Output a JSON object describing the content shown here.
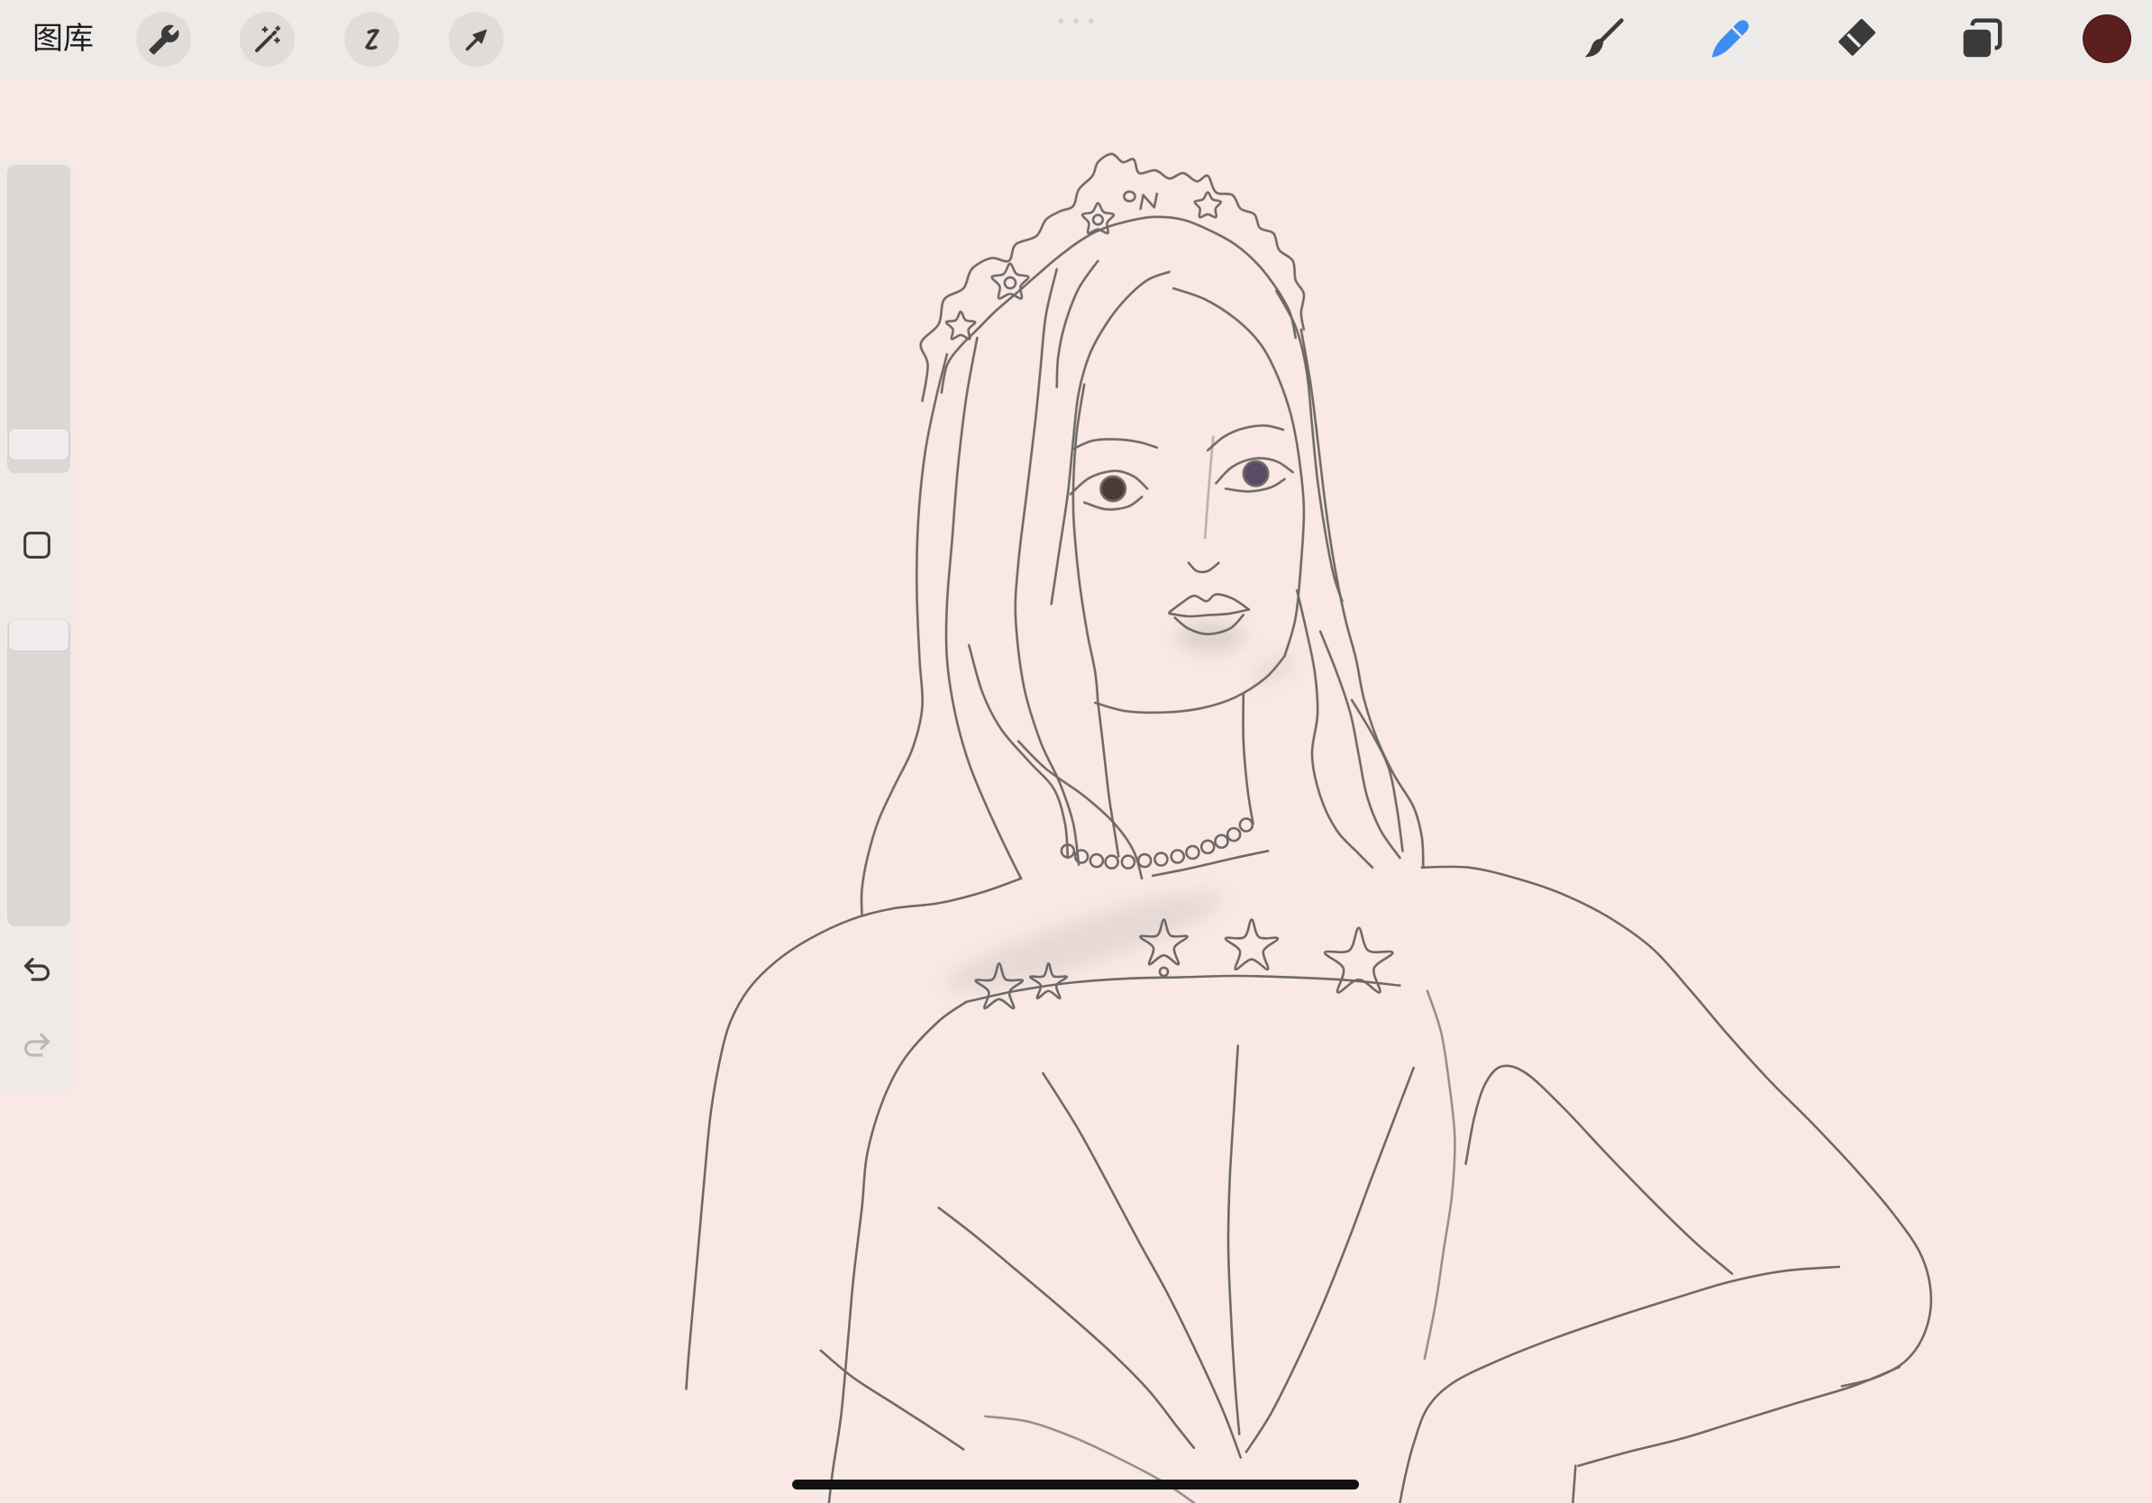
{
  "toolbar": {
    "gallery_label": "图库",
    "left_tool_icons": [
      "wrench-icon",
      "magic-wand-icon",
      "selection-icon",
      "transform-arrow-icon"
    ],
    "right_tool_icons": [
      "brush-icon",
      "smudge-icon",
      "eraser-icon",
      "layers-icon"
    ],
    "active_tool_icon": "smudge-icon",
    "active_tool_color": "#3d8df5",
    "icon_color": "#3a3a3a",
    "active_color": "#5b1f1d"
  },
  "sidebar": {
    "brush_size_level": 0.05,
    "opacity_level": 1.0,
    "modify_icon": "square-icon",
    "undo_icon": "undo-icon",
    "redo_icon": "redo-icon",
    "redo_enabled": false
  },
  "canvas": {
    "background_color": "#f9e8e4",
    "line_color": "#6e6a68",
    "left_iris_color": "#4b3b37",
    "right_iris_color": "#5b4a63"
  }
}
